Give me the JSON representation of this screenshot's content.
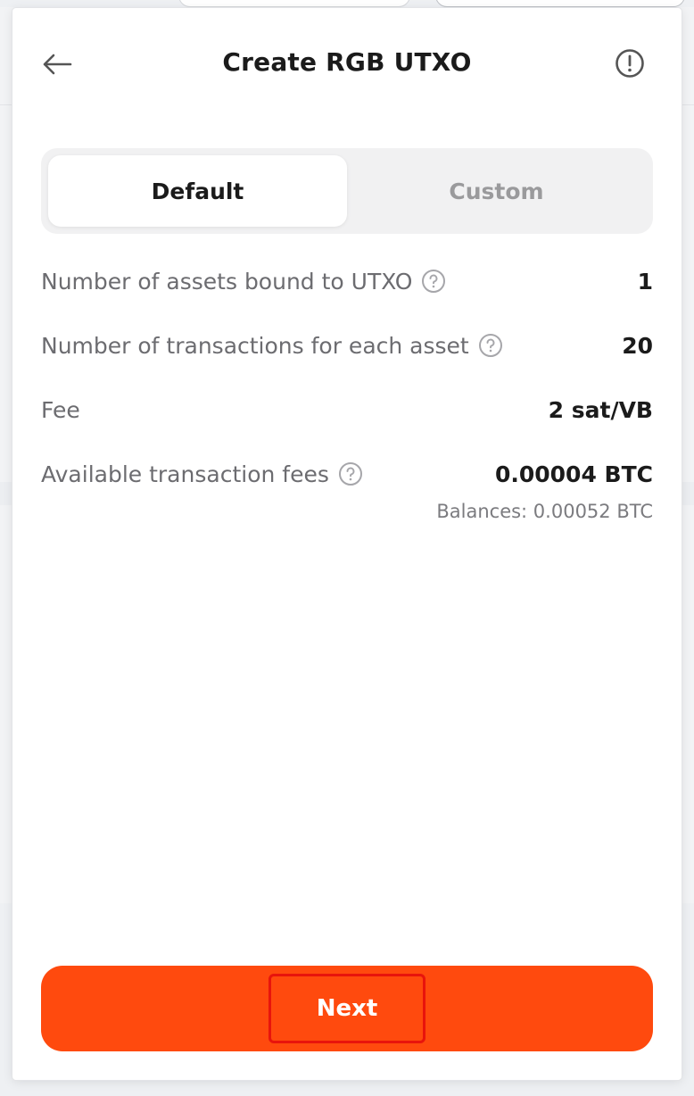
{
  "header": {
    "title": "Create RGB UTXO"
  },
  "tabs": [
    {
      "label": "Default",
      "active": true
    },
    {
      "label": "Custom",
      "active": false
    }
  ],
  "details": {
    "assets_bound_label": "Number of assets bound to UTXO",
    "assets_bound_value": "1",
    "tx_per_asset_label": "Number of transactions for each asset",
    "tx_per_asset_value": "20",
    "fee_label": "Fee",
    "fee_value": "2 sat/VB",
    "available_fees_label": "Available transaction fees",
    "available_fees_value": "0.00004 BTC",
    "balances_text": "Balances: 0.00052 BTC"
  },
  "footer": {
    "next_label": "Next"
  },
  "colors": {
    "accent": "#ff4a0e",
    "highlight_border": "#e8140c",
    "tab_track": "#f1f1f2",
    "muted_text": "#6c6c70"
  },
  "icons": {
    "back": "arrow-left-icon",
    "info": "exclamation-circle-icon",
    "help": "question-circle-icon"
  }
}
